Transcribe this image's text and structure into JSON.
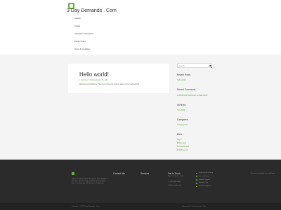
{
  "site": {
    "title": "3 Day Demands . Com"
  },
  "menu": [
    "Articles",
    "Guides",
    "Newsletter Subscription",
    "Privacy Policy",
    "Terms & Conditions"
  ],
  "post": {
    "title": "Hello world!",
    "meta": "1 Comment / Uncategorized / By mdb",
    "body": "Welcome to WordPress. This is your first post. Edit or delete it, then start writing!"
  },
  "sidebar": {
    "search_placeholder": "Search",
    "recent_posts_title": "Recent Posts",
    "recent_posts": [
      "Hello world!"
    ],
    "recent_comments_title": "Recent Comments",
    "recent_comments": [
      "A WordPress Commenter on Hello world!"
    ],
    "archives_title": "Archives",
    "archives": [
      "June 2020"
    ],
    "categories_title": "Categories",
    "categories": [
      "Uncategorized"
    ],
    "meta_title": "Meta",
    "meta": [
      "Log in",
      "Entries feed",
      "Comments feed",
      "WordPress.org"
    ]
  },
  "footer": {
    "about": "There's a website about what you've been thinking, a site about where to shop, and one that's just plain fun. Let us help you find what you're looking for.",
    "contact_title": "Contact Info",
    "services_title": "Services",
    "get_in_touch_title": "Get In Touch",
    "hours": "Mon – Fri 9:00 – 17:00",
    "phone": "+1 (123) 456 7890",
    "email": "info@example.com",
    "services_list": [
      "Professional Hosting",
      "Server Hosting",
      "Website Support",
      "Website Care",
      "Web Development"
    ],
    "right_text": "Be sure to find what you need here",
    "copyright": "Copyright © 2023 3 Day Demands . Com",
    "powered": "Powered by 3 Day Demands . Com"
  },
  "colors": {
    "accent": "#6cae3e",
    "footer_bg": "#2b2b2b",
    "page_bg": "#f4f4f4"
  },
  "icons": {
    "logo": "square-logo-icon",
    "search": "search-icon"
  }
}
